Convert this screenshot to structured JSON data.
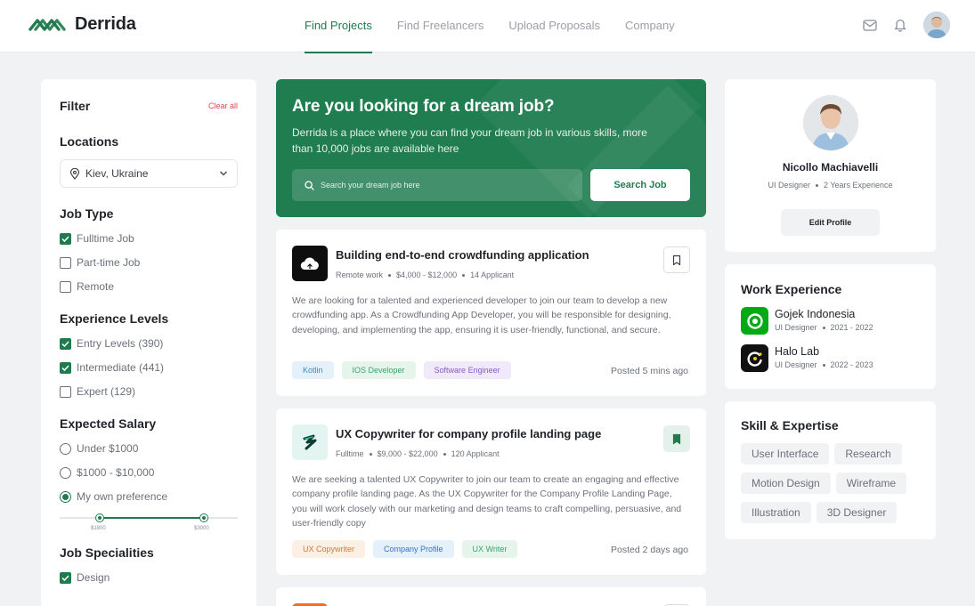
{
  "brand": {
    "name": "Derrida",
    "color": "#207a4f"
  },
  "nav": [
    {
      "label": "Find Projects",
      "active": true
    },
    {
      "label": "Find Freelancers",
      "active": false
    },
    {
      "label": "Upload Proposals",
      "active": false
    },
    {
      "label": "Company",
      "active": false
    }
  ],
  "header_icons": [
    "mail-icon",
    "bell-icon",
    "avatar"
  ],
  "filter": {
    "title": "Filter",
    "clear_label": "Clear all",
    "locations": {
      "title": "Locations",
      "value": "Kiev, Ukraine"
    },
    "job_type": {
      "title": "Job Type",
      "options": [
        {
          "label": "Fulltime Job",
          "checked": true
        },
        {
          "label": "Part-time Job",
          "checked": false
        },
        {
          "label": "Remote",
          "checked": false
        }
      ]
    },
    "experience": {
      "title": "Experience Levels",
      "options": [
        {
          "label": "Entry Levels (390)",
          "checked": true
        },
        {
          "label": "Intermediate (441)",
          "checked": true
        },
        {
          "label": "Expert (129)",
          "checked": false
        }
      ]
    },
    "salary": {
      "title": "Expected Salary",
      "options": [
        {
          "label": "Under $1000",
          "selected": false
        },
        {
          "label": "$1000 - $10,000",
          "selected": false
        },
        {
          "label": "My own preference",
          "selected": true
        }
      ],
      "range_min": "$1800",
      "range_max": "$3000"
    },
    "specialities": {
      "title": "Job Specialities",
      "options": [
        {
          "label": "Design",
          "checked": true
        }
      ]
    }
  },
  "hero": {
    "title": "Are you looking  for a dream job?",
    "subtitle": "Derrida is a place where you can find your dream job in various skills, more than 10,000 jobs are available here",
    "search_placeholder": "Search your dream job here",
    "search_button": "Search Job",
    "color": "#1f7d50"
  },
  "jobs": [
    {
      "title": "Building end-to-end crowdfunding application",
      "meta": [
        "Remote work",
        "$4,000 - $12,000",
        "14 Applicant"
      ],
      "description": "We are looking for a talented and experienced developer to join our team to develop a new crowdfunding app. As a Crowdfunding App Developer, you will be responsible for designing, developing, and implementing the app, ensuring it is user-friendly, functional, and secure.",
      "tags": [
        "Kotlin",
        "IOS Developer",
        "Software Engineer"
      ],
      "posted": "Posted 5 mins ago",
      "bookmarked": false,
      "logo_icon": "cloud-icon"
    },
    {
      "title": "UX Copywriter for company profile landing page",
      "meta": [
        "Fulltime",
        "$9,000 - $22,000",
        "120 Applicant"
      ],
      "description": "We are seeking a talented UX Copywriter to join our team to create an engaging and effective company profile landing page. As the UX Copywriter for the Company Profile Landing Page, you will work closely with our marketing and design teams to craft compelling, persuasive, and user-friendly copy",
      "tags": [
        "UX Copywriter",
        "Company Profile",
        "UX Writer"
      ],
      "posted": "Posted 2 days ago",
      "bookmarked": true,
      "logo_icon": "zigzag-icon"
    }
  ],
  "profile": {
    "name": "Nicollo Machiavelli",
    "role": "UI Designer",
    "experience": "2 Years Experience",
    "edit_button": "Edit Profile"
  },
  "work": {
    "title": "Work Experience",
    "items": [
      {
        "company": "Gojek Indonesia",
        "role": "UI Designer",
        "period": "2021 - 2022",
        "logo_color": "#00aa13"
      },
      {
        "company": "Halo Lab",
        "role": "UI Designer",
        "period": "2022 - 2023",
        "logo_color": "#111111"
      }
    ]
  },
  "skills": {
    "title": "Skill & Expertise",
    "items": [
      "User Interface",
      "Research",
      "Motion Design",
      "Wireframe",
      "Illustration",
      "3D Designer"
    ]
  }
}
